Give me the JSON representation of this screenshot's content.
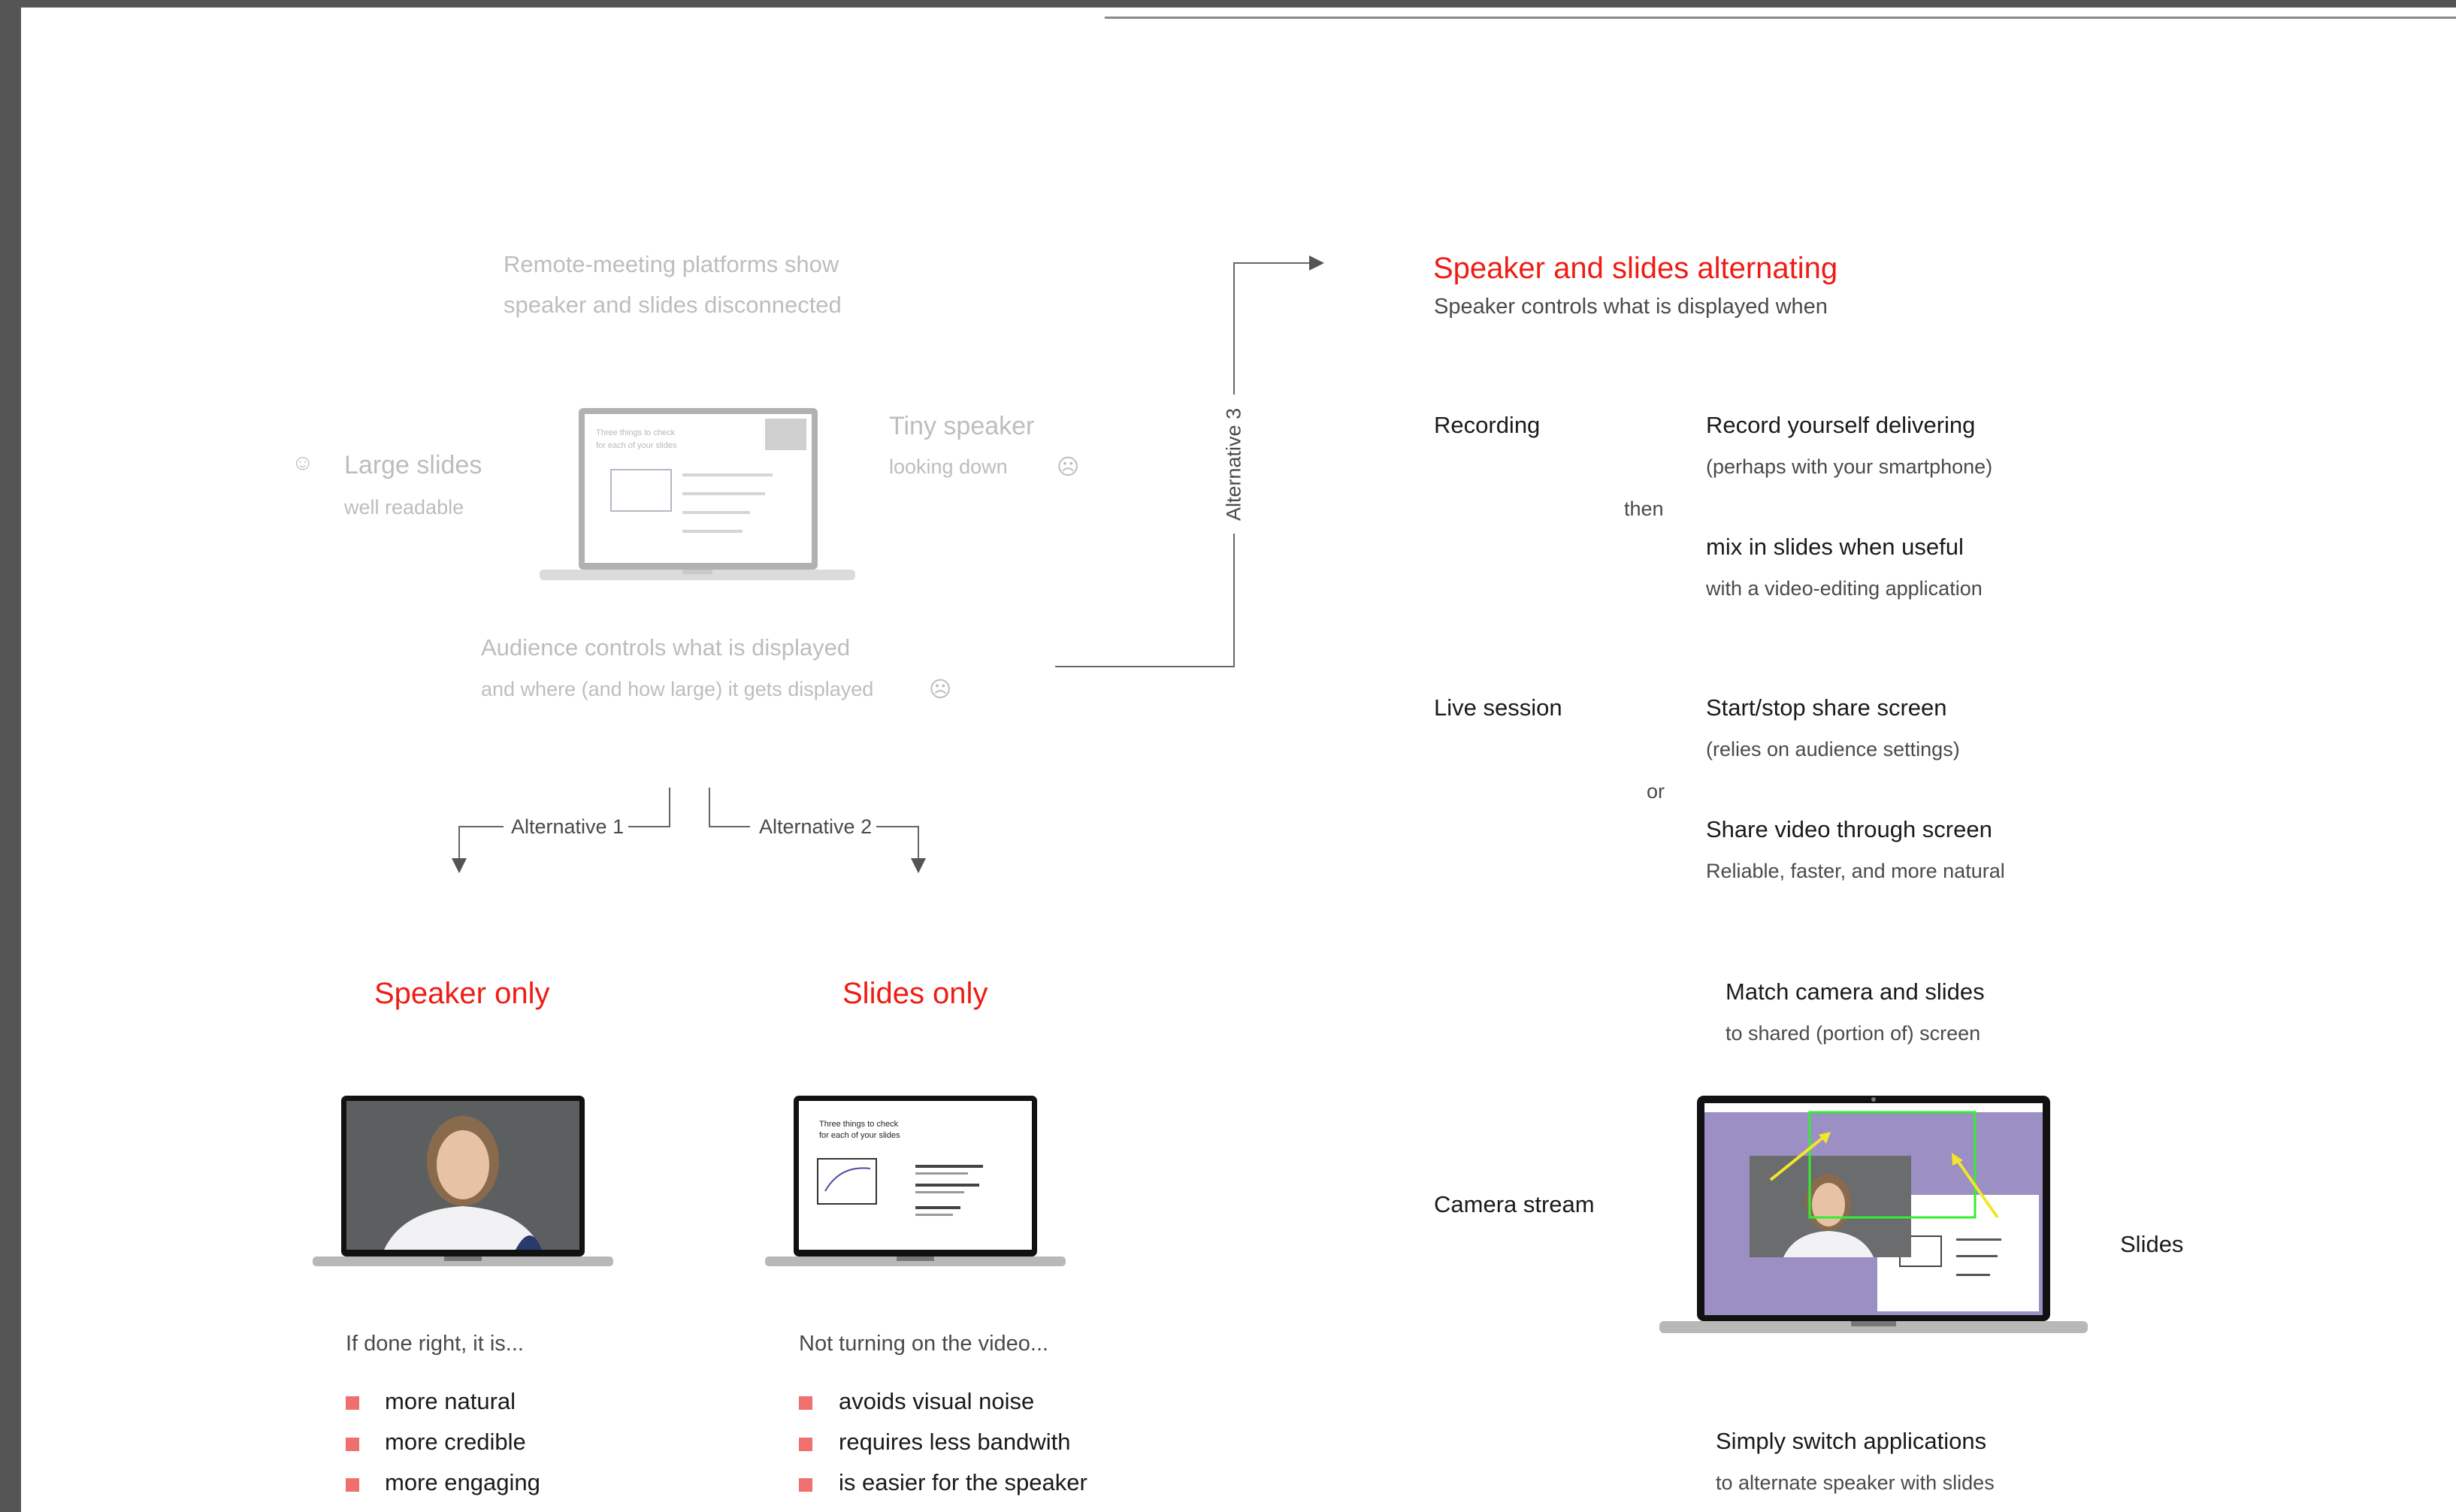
{
  "intro": {
    "title_line1": "Remote-meeting platforms show",
    "title_line2": "speaker and slides disconnected",
    "large_slides": "Large slides",
    "large_slides_sub": "well readable",
    "tiny_speaker": "Tiny speaker",
    "tiny_speaker_sub": "looking down",
    "audience": "Audience controls what is displayed",
    "audience_sub": "and where (and how large) it gets displayed",
    "preview_slide_line1": "Three things to check",
    "preview_slide_line2": "for each of your slides"
  },
  "alternatives": {
    "alt1": "Alternative 1",
    "alt2": "Alternative 2",
    "alt3": "Alternative 3"
  },
  "speaker_only": {
    "title": "Speaker only",
    "intro": "If done right, it is...",
    "bullets": [
      "more natural",
      "more credible",
      "more engaging"
    ]
  },
  "slides_only": {
    "title": "Slides only",
    "intro": "Not turning on the video...",
    "bullets": [
      "avoids visual noise",
      "requires less bandwith",
      "is easier for the speaker"
    ],
    "slide_line1": "Three things to check",
    "slide_line2": "for each of your slides"
  },
  "alternating": {
    "title": "Speaker and slides alternating",
    "subtitle": "Speaker controls what is displayed when",
    "recording": {
      "label": "Recording",
      "opt1_title": "Record yourself delivering",
      "opt1_sub": "(perhaps with your smartphone)",
      "connector": "then",
      "opt2_title": "mix in slides when useful",
      "opt2_sub": "with a video-editing application"
    },
    "live": {
      "label": "Live session",
      "opt1_title": "Start/stop share screen",
      "opt1_sub": "(relies on audience settings)",
      "connector": "or",
      "opt2_title": "Share video through screen",
      "opt2_sub": "Reliable, faster, and more natural"
    },
    "match_title": "Match camera and slides",
    "match_sub": "to shared (portion of) screen",
    "camera_stream": "Camera stream",
    "slides": "Slides",
    "switch_title": "Simply switch applications",
    "switch_sub": "to alternate speaker with slides"
  },
  "colors": {
    "accent_red": "#ee1c14",
    "bullet_pink": "#f07070",
    "screen_purple": "#9b8fc4",
    "frame_green": "#33ee33",
    "arrow_yellow": "#f2e62a"
  }
}
